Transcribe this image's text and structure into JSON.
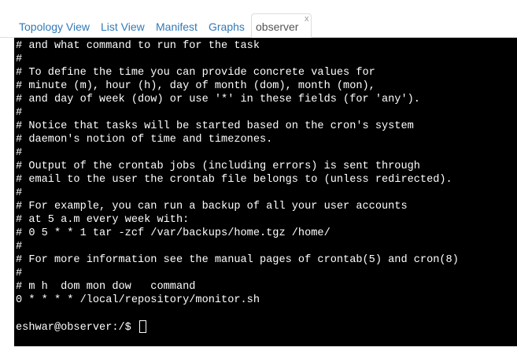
{
  "tabs": [
    {
      "label": "Topology View"
    },
    {
      "label": "List View"
    },
    {
      "label": "Manifest"
    },
    {
      "label": "Graphs"
    },
    {
      "label": "observer",
      "close": "x"
    }
  ],
  "terminal": {
    "lines": [
      "# and what command to run for the task",
      "#",
      "# To define the time you can provide concrete values for",
      "# minute (m), hour (h), day of month (dom), month (mon),",
      "# and day of week (dow) or use '*' in these fields (for 'any').",
      "#",
      "# Notice that tasks will be started based on the cron's system",
      "# daemon's notion of time and timezones.",
      "#",
      "# Output of the crontab jobs (including errors) is sent through",
      "# email to the user the crontab file belongs to (unless redirected).",
      "#",
      "# For example, you can run a backup of all your user accounts",
      "# at 5 a.m every week with:",
      "# 0 5 * * 1 tar -zcf /var/backups/home.tgz /home/",
      "#",
      "# For more information see the manual pages of crontab(5) and cron(8)",
      "#",
      "# m h  dom mon dow   command",
      "0 * * * * /local/repository/monitor.sh",
      ""
    ],
    "prompt": "eshwar@observer:/$ "
  }
}
